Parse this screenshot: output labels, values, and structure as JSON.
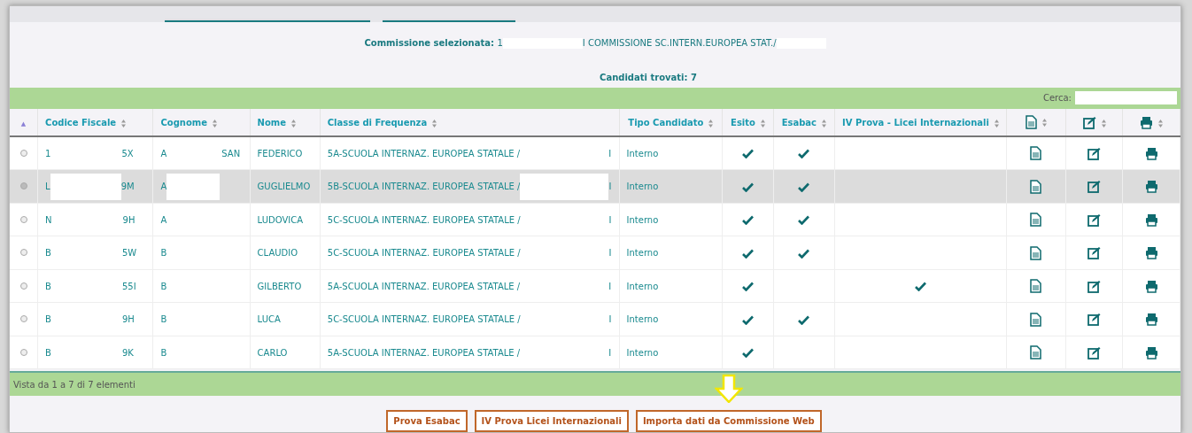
{
  "commission": {
    "label": "Commissione selezionata:",
    "code_start": "1",
    "name": "I COMMISSIONE SC.INTERN.EUROPEA STAT./"
  },
  "found": "Candidati trovati: 7",
  "search": {
    "label": "Cerca:"
  },
  "table": {
    "columns": [
      {
        "kind": "sort",
        "label": "▲"
      },
      {
        "kind": "text",
        "label": "Codice Fiscale"
      },
      {
        "kind": "text",
        "label": "Cognome"
      },
      {
        "kind": "text",
        "label": "Nome"
      },
      {
        "kind": "text",
        "label": "Classe di Frequenza"
      },
      {
        "kind": "text",
        "label": "Tipo Candidato"
      },
      {
        "kind": "text",
        "label": "Esito"
      },
      {
        "kind": "text",
        "label": "Esabac"
      },
      {
        "kind": "text",
        "label": "IV Prova - Licei Internazionali"
      },
      {
        "kind": "doc"
      },
      {
        "kind": "edit"
      },
      {
        "kind": "print"
      }
    ],
    "rows": [
      {
        "selected": false,
        "codice": [
          "1",
          "5X"
        ],
        "cognome": [
          "A",
          "SAN"
        ],
        "nome": "FEDERICO",
        "classe": [
          "5A-SCUOLA INTERNAZ. EUROPEA STATALE /",
          "I"
        ],
        "tipo": "Interno",
        "esito": true,
        "esabac": true,
        "iv_prova": false
      },
      {
        "selected": true,
        "codice": [
          "L",
          "9M"
        ],
        "cognome": [
          "A"
        ],
        "nome": "GUGLIELMO",
        "classe": [
          "5B-SCUOLA INTERNAZ. EUROPEA STATALE /",
          "I"
        ],
        "tipo": "Interno",
        "esito": true,
        "esabac": true,
        "iv_prova": false
      },
      {
        "selected": false,
        "codice": [
          "N",
          "9H"
        ],
        "cognome": [
          "A"
        ],
        "nome": "LUDOVICA",
        "classe": [
          "5C-SCUOLA INTERNAZ. EUROPEA STATALE /",
          "I"
        ],
        "tipo": "Interno",
        "esito": true,
        "esabac": true,
        "iv_prova": false
      },
      {
        "selected": false,
        "codice": [
          "B",
          "5W"
        ],
        "cognome": [
          "B"
        ],
        "nome": "CLAUDIO",
        "classe": [
          "5C-SCUOLA INTERNAZ. EUROPEA STATALE /",
          "I"
        ],
        "tipo": "Interno",
        "esito": true,
        "esabac": true,
        "iv_prova": false
      },
      {
        "selected": false,
        "codice": [
          "B",
          "55I"
        ],
        "cognome": [
          "B"
        ],
        "nome": "GILBERTO",
        "classe": [
          "5A-SCUOLA INTERNAZ. EUROPEA STATALE /",
          "I"
        ],
        "tipo": "Interno",
        "esito": true,
        "esabac": false,
        "iv_prova": true
      },
      {
        "selected": false,
        "codice": [
          "B",
          "9H"
        ],
        "cognome": [
          "B"
        ],
        "nome": "LUCA",
        "classe": [
          "5C-SCUOLA INTERNAZ. EUROPEA STATALE /",
          "I"
        ],
        "tipo": "Interno",
        "esito": true,
        "esabac": true,
        "iv_prova": false
      },
      {
        "selected": false,
        "codice": [
          "B",
          "9K"
        ],
        "cognome": [
          "B"
        ],
        "nome": "CARLO",
        "classe": [
          "5A-SCUOLA INTERNAZ. EUROPEA STATALE /",
          "I"
        ],
        "tipo": "Interno",
        "esito": true,
        "esabac": false,
        "iv_prova": false
      }
    ]
  },
  "info": "Vista da 1 a 7 di 7 elementi",
  "buttons": [
    "Prova Esabac",
    "IV Prova Licei Internazionali",
    "Importa dati da Commissione Web"
  ]
}
